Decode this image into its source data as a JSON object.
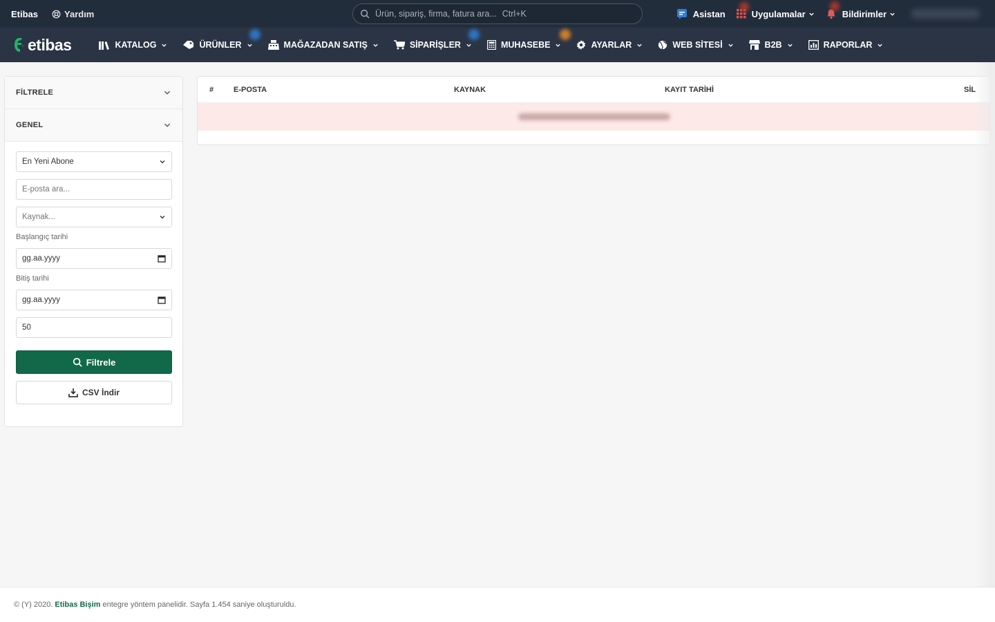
{
  "topbar": {
    "brand": "Etibas",
    "help": "Yardım",
    "search_placeholder": "Ürün, sipariş, firma, fatura ara...",
    "search_shortcut": "Ctrl+K",
    "assistant": "Asistan",
    "apps": "Uygulamalar",
    "notifications": "Bildirimler"
  },
  "logo": {
    "word": "etibas"
  },
  "nav": {
    "catalog": "KATALOG",
    "products": "ÜRÜNLER",
    "store_sales": "MAĞAZADAN SATIŞ",
    "orders": "SİPARİŞLER",
    "accounting": "MUHASEBE",
    "settings": "AYARLAR",
    "website": "WEB SİTESİ",
    "b2b": "B2B",
    "reports": "RAPORLAR"
  },
  "filter_panel": {
    "filter_title": "FİLTRELE",
    "general_title": "GENEL",
    "sort_value": "En Yeni Abone",
    "email_placeholder": "E-posta ara...",
    "source_placeholder": "Kaynak...",
    "start_date_label": "Başlangıç tarihi",
    "start_date_value": "gg.aa.yyyy",
    "end_date_label": "Bitiş tarihi",
    "end_date_value": "gg.aa.yyyy",
    "limit_value": "50",
    "filter_button": "Filtrele",
    "csv_button": "CSV İndir"
  },
  "table": {
    "columns": [
      "#",
      "E-POSTA",
      "KAYNAK",
      "KAYIT TARİHİ",
      "SİL"
    ]
  },
  "footer": {
    "prefix": "© (Y) 2020.",
    "link": "Etibas Bişim",
    "suffix": "entegre yöntem panelidir. Sayfa 1.454 saniye oluşturuldu."
  },
  "colors": {
    "topbar_bg": "#222d3c",
    "navbar_bg": "#2a3444",
    "primary_green": "#12694a",
    "empty_row_bg": "#fde9e8"
  }
}
